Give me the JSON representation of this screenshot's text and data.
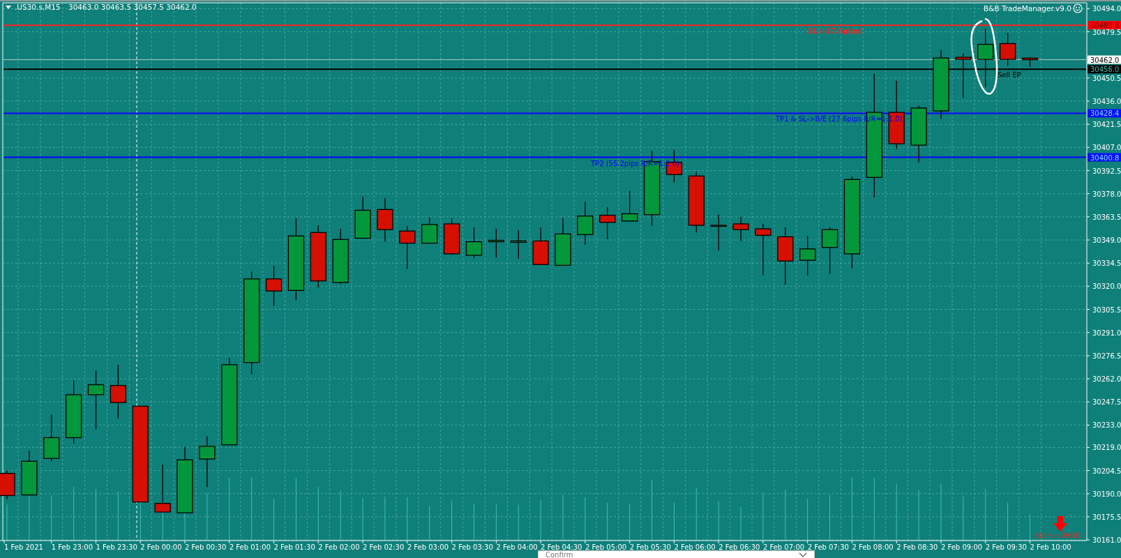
{
  "chart": {
    "symbol": ".US30.s,M15",
    "quote": "30463.0 30463.5 30457.5 30462.0",
    "indicator": "B&B TradeManager.v9.0",
    "price_axis": [
      "30494.0",
      "30479.5",
      "30450.5",
      "30436.0",
      "30421.5",
      "30407.0",
      "30392.5",
      "30378.0",
      "30363.5",
      "30349.0",
      "30334.5",
      "30320.0",
      "30305.5",
      "30291.0",
      "30276.5",
      "30262.0",
      "30247.5",
      "30233.0",
      "30219.0",
      "30204.5",
      "30190.0",
      "30175.5",
      "30161.0"
    ],
    "time_axis": [
      "1 Feb 2021",
      "1 Feb 23:00",
      "1 Feb 23:30",
      "2 Feb 00:00",
      "2 Feb 00:30",
      "2 Feb 01:00",
      "2 Feb 01:30",
      "2 Feb 02:00",
      "2 Feb 02:30",
      "2 Feb 03:00",
      "2 Feb 03:30",
      "2 Feb 04:00",
      "2 Feb 04:30",
      "2 Feb 05:00",
      "2 Feb 05:30",
      "2 Feb 06:00",
      "2 Feb 06:30",
      "2 Feb 07:00",
      "2 Feb 07:30",
      "2 Feb 08:00",
      "2 Feb 08:30",
      "2 Feb 09:00",
      "2 Feb 09:30",
      "2 Feb 10:00"
    ],
    "price_lines": [
      {
        "kind": "sl",
        "text": "SL (-27.6pips)",
        "tag": "30483.6"
      },
      {
        "kind": "bid",
        "tag": "30462.0"
      },
      {
        "kind": "entry",
        "text": "Sell EP",
        "tag": "30456.0"
      },
      {
        "kind": "tp",
        "text": "TP1 & SL->B/E (27.6pips R/R=1:1.0)",
        "tag": "30428.4"
      },
      {
        "kind": "tp",
        "text": "TP2 (55.2pips R/R=1:2.0)",
        "tag": "30400.8"
      }
    ],
    "signal": {
      "text": "(15min 09:30)"
    }
  },
  "dialog": {
    "title": "Confirm"
  }
}
